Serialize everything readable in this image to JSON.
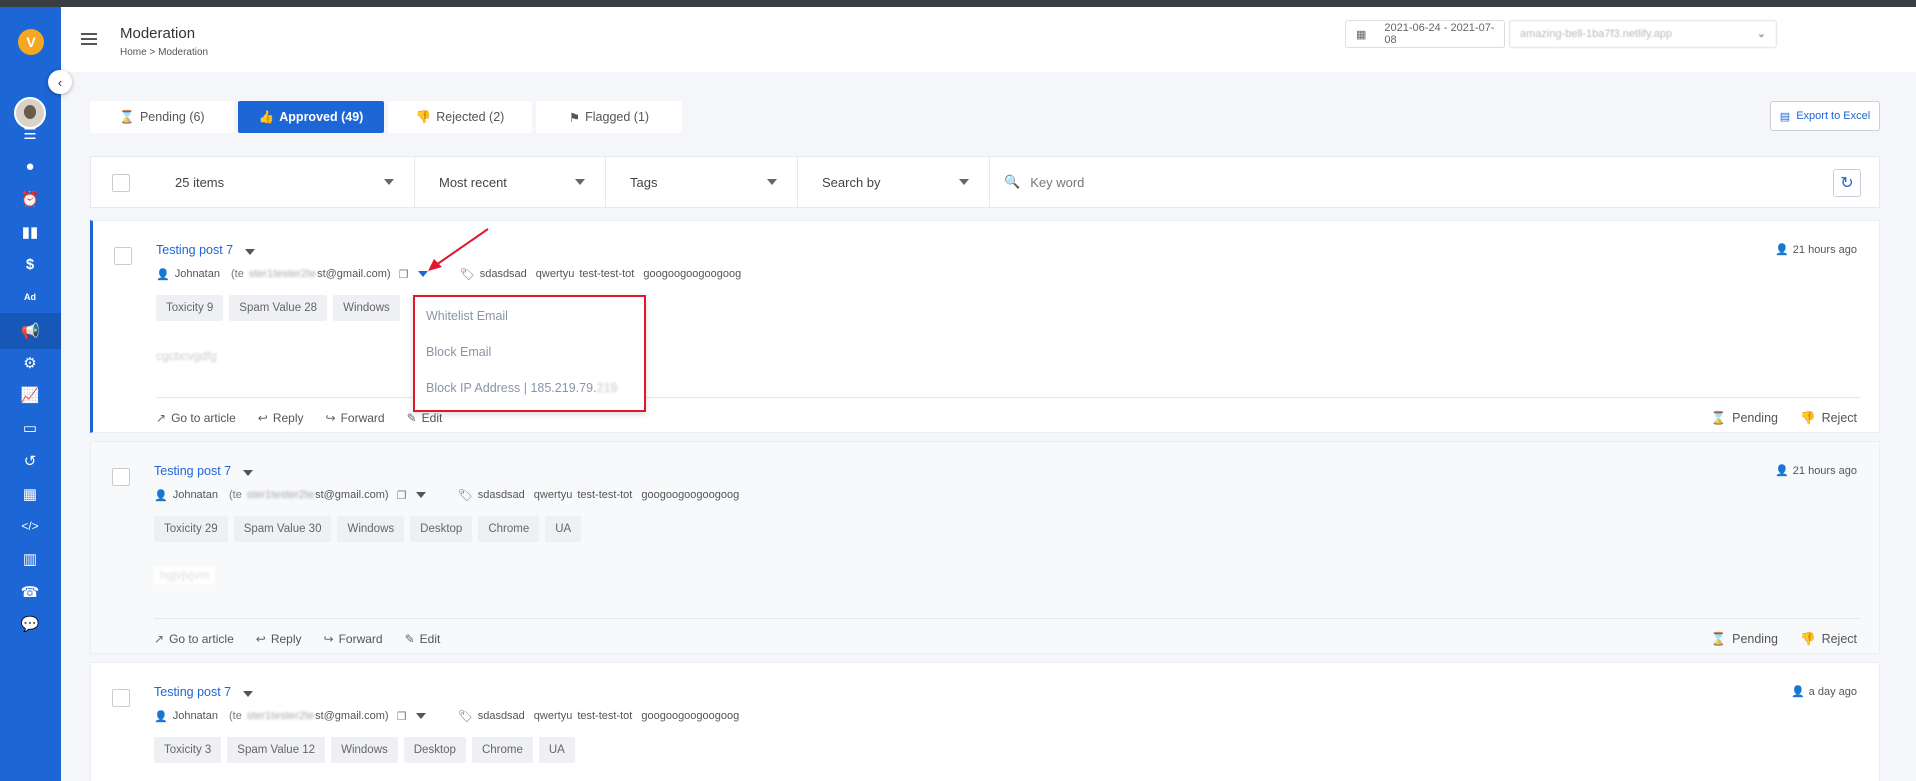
{
  "header": {
    "title": "Moderation",
    "breadcrumb": "Home  >  Moderation",
    "date_range": "2021-06-24 - 2021-07-08",
    "site_select": "amazing-bell-1ba7f3.netlify.app"
  },
  "tabs": [
    {
      "label": "Pending (6)"
    },
    {
      "label": "Approved (49)"
    },
    {
      "label": "Rejected (2)"
    },
    {
      "label": "Flagged (1)"
    }
  ],
  "export_label": "Export to Excel",
  "filters": {
    "items_per_page": "25 items",
    "sort": "Most recent",
    "tags": "Tags",
    "search_by": "Search by",
    "keyword_placeholder": "Key word"
  },
  "posts": [
    {
      "title": "Testing post 7",
      "author": "Johnatan",
      "email_hidden": "(tester1tester2test@gmail.com)",
      "email_prefix": "(te",
      "email_mid": "ster1tester2te",
      "email_tail": "st@gmail.com)",
      "tags": [
        "sdasdsad",
        "qwertyu",
        "test-test-tot",
        "googoogoogoogoog"
      ],
      "chips": [
        "Toxicity 9",
        "Spam Value 28",
        "Windows"
      ],
      "body": "cgcbcvgdfg",
      "time": "21 hours ago"
    },
    {
      "title": "Testing post 7",
      "author": "Johnatan",
      "email_prefix": "(te",
      "email_mid": "ster1tester2te",
      "email_tail": "st@gmail.com)",
      "tags": [
        "sdasdsad",
        "qwertyu",
        "test-test-tot",
        "googoogoogoogoog"
      ],
      "chips": [
        "Toxicity 29",
        "Spam Value 30",
        "Windows",
        "Desktop",
        "Chrome",
        "UA"
      ],
      "body": "hgjvjvjvm",
      "time": "21 hours ago"
    },
    {
      "title": "Testing post 7",
      "author": "Johnatan",
      "email_prefix": "(te",
      "email_mid": "ster1tester2te",
      "email_tail": "st@gmail.com)",
      "tags": [
        "sdasdsad",
        "qwertyu",
        "test-test-tot",
        "googoogoogoogoog"
      ],
      "chips": [
        "Toxicity 3",
        "Spam Value 12",
        "Windows",
        "Desktop",
        "Chrome",
        "UA"
      ],
      "time": "a day ago"
    }
  ],
  "post_actions": {
    "go_to_article": "Go to article",
    "reply": "Reply",
    "forward": "Forward",
    "edit": "Edit",
    "pending": "Pending",
    "reject": "Reject"
  },
  "menu": {
    "whitelist": "Whitelist Email",
    "block_email": "Block Email",
    "block_ip": "Block IP Address | 185.219.79.",
    "block_ip_hidden": "219"
  },
  "colors": {
    "primary": "#1d66d6",
    "highlight_border": "#e0182d"
  }
}
